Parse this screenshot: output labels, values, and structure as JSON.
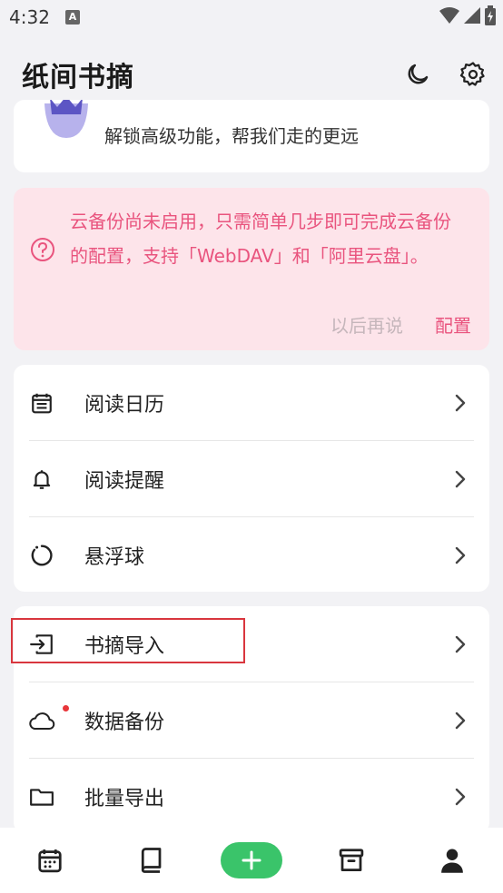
{
  "status_bar": {
    "time": "4:32",
    "notif_letter": "A"
  },
  "app": {
    "title": "纸间书摘"
  },
  "vip": {
    "text": "解锁高级功能，帮我们走的更远"
  },
  "backup_banner": {
    "message": "云备份尚未启用，只需简单几步即可完成云备份的配置，支持「WebDAV」和「阿里云盘」。",
    "later_label": "以后再说",
    "config_label": "配置"
  },
  "group1": [
    {
      "icon": "calendar-icon",
      "label": "阅读日历"
    },
    {
      "icon": "bell-icon",
      "label": "阅读提醒"
    },
    {
      "icon": "loading-circle-icon",
      "label": "悬浮球"
    }
  ],
  "group2": [
    {
      "icon": "import-icon",
      "label": "书摘导入"
    },
    {
      "icon": "cloud-icon",
      "label": "数据备份",
      "badge": true
    },
    {
      "icon": "folder-icon",
      "label": "批量导出"
    }
  ],
  "bottom_nav": [
    "calendar-icon",
    "book-icon",
    "add-icon",
    "archive-icon",
    "person-icon"
  ],
  "colors": {
    "accent_pink": "#e9547e",
    "banner_bg": "#fde4ea",
    "fab_green": "#3ac46a",
    "highlight_red": "#d9363e"
  }
}
